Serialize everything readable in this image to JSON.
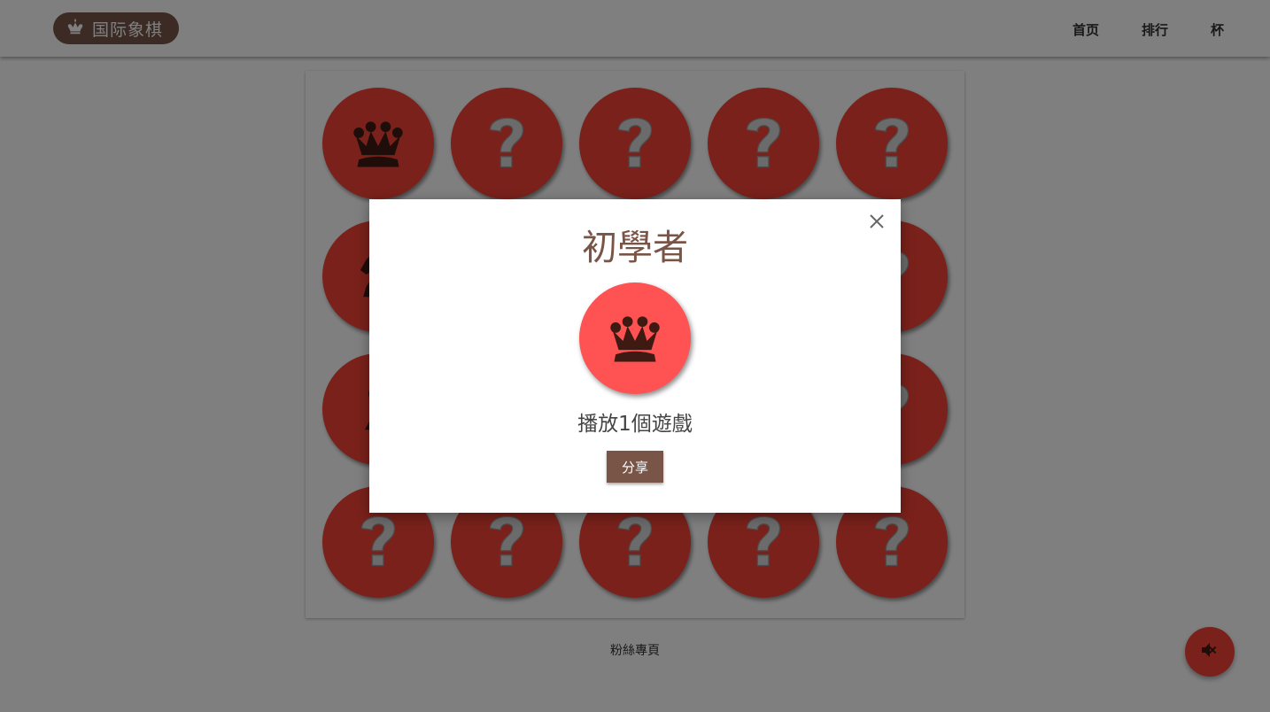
{
  "header": {
    "logo_text": "国际象棋",
    "logo_icon": "chess-king-icon",
    "nav": [
      "首页",
      "排行",
      "杯"
    ]
  },
  "board": {
    "tiles": [
      "crown",
      "question",
      "question",
      "question",
      "question",
      "knight",
      "question",
      "question",
      "question",
      "question",
      "pawn",
      "question",
      "question",
      "question",
      "question",
      "question",
      "question",
      "question",
      "question",
      "question"
    ]
  },
  "footer": {
    "link": "粉絲專頁"
  },
  "fab": {
    "icon": "volume-off-icon"
  },
  "modal": {
    "title": "初學者",
    "badge_icon": "crown-icon",
    "subtitle": "播放1個遊戲",
    "share_label": "分享",
    "close_icon": "close-icon"
  },
  "colors": {
    "brand": "#795548",
    "tile_red": "#f44336",
    "badge_red": "#ff5252",
    "icon_dark": "#3e1a12",
    "question_gray": "#d6d6d6"
  }
}
